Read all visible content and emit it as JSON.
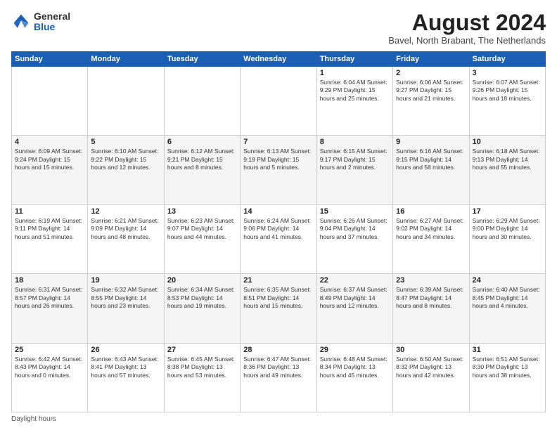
{
  "header": {
    "logo_general": "General",
    "logo_blue": "Blue",
    "month_year": "August 2024",
    "location": "Bavel, North Brabant, The Netherlands"
  },
  "columns": [
    "Sunday",
    "Monday",
    "Tuesday",
    "Wednesday",
    "Thursday",
    "Friday",
    "Saturday"
  ],
  "weeks": [
    [
      {
        "day": "",
        "info": ""
      },
      {
        "day": "",
        "info": ""
      },
      {
        "day": "",
        "info": ""
      },
      {
        "day": "",
        "info": ""
      },
      {
        "day": "1",
        "info": "Sunrise: 6:04 AM\nSunset: 9:29 PM\nDaylight: 15 hours and 25 minutes."
      },
      {
        "day": "2",
        "info": "Sunrise: 6:06 AM\nSunset: 9:27 PM\nDaylight: 15 hours and 21 minutes."
      },
      {
        "day": "3",
        "info": "Sunrise: 6:07 AM\nSunset: 9:26 PM\nDaylight: 15 hours and 18 minutes."
      }
    ],
    [
      {
        "day": "4",
        "info": "Sunrise: 6:09 AM\nSunset: 9:24 PM\nDaylight: 15 hours and 15 minutes."
      },
      {
        "day": "5",
        "info": "Sunrise: 6:10 AM\nSunset: 9:22 PM\nDaylight: 15 hours and 12 minutes."
      },
      {
        "day": "6",
        "info": "Sunrise: 6:12 AM\nSunset: 9:21 PM\nDaylight: 15 hours and 8 minutes."
      },
      {
        "day": "7",
        "info": "Sunrise: 6:13 AM\nSunset: 9:19 PM\nDaylight: 15 hours and 5 minutes."
      },
      {
        "day": "8",
        "info": "Sunrise: 6:15 AM\nSunset: 9:17 PM\nDaylight: 15 hours and 2 minutes."
      },
      {
        "day": "9",
        "info": "Sunrise: 6:16 AM\nSunset: 9:15 PM\nDaylight: 14 hours and 58 minutes."
      },
      {
        "day": "10",
        "info": "Sunrise: 6:18 AM\nSunset: 9:13 PM\nDaylight: 14 hours and 55 minutes."
      }
    ],
    [
      {
        "day": "11",
        "info": "Sunrise: 6:19 AM\nSunset: 9:11 PM\nDaylight: 14 hours and 51 minutes."
      },
      {
        "day": "12",
        "info": "Sunrise: 6:21 AM\nSunset: 9:09 PM\nDaylight: 14 hours and 48 minutes."
      },
      {
        "day": "13",
        "info": "Sunrise: 6:23 AM\nSunset: 9:07 PM\nDaylight: 14 hours and 44 minutes."
      },
      {
        "day": "14",
        "info": "Sunrise: 6:24 AM\nSunset: 9:06 PM\nDaylight: 14 hours and 41 minutes."
      },
      {
        "day": "15",
        "info": "Sunrise: 6:26 AM\nSunset: 9:04 PM\nDaylight: 14 hours and 37 minutes."
      },
      {
        "day": "16",
        "info": "Sunrise: 6:27 AM\nSunset: 9:02 PM\nDaylight: 14 hours and 34 minutes."
      },
      {
        "day": "17",
        "info": "Sunrise: 6:29 AM\nSunset: 9:00 PM\nDaylight: 14 hours and 30 minutes."
      }
    ],
    [
      {
        "day": "18",
        "info": "Sunrise: 6:31 AM\nSunset: 8:57 PM\nDaylight: 14 hours and 26 minutes."
      },
      {
        "day": "19",
        "info": "Sunrise: 6:32 AM\nSunset: 8:55 PM\nDaylight: 14 hours and 23 minutes."
      },
      {
        "day": "20",
        "info": "Sunrise: 6:34 AM\nSunset: 8:53 PM\nDaylight: 14 hours and 19 minutes."
      },
      {
        "day": "21",
        "info": "Sunrise: 6:35 AM\nSunset: 8:51 PM\nDaylight: 14 hours and 15 minutes."
      },
      {
        "day": "22",
        "info": "Sunrise: 6:37 AM\nSunset: 8:49 PM\nDaylight: 14 hours and 12 minutes."
      },
      {
        "day": "23",
        "info": "Sunrise: 6:39 AM\nSunset: 8:47 PM\nDaylight: 14 hours and 8 minutes."
      },
      {
        "day": "24",
        "info": "Sunrise: 6:40 AM\nSunset: 8:45 PM\nDaylight: 14 hours and 4 minutes."
      }
    ],
    [
      {
        "day": "25",
        "info": "Sunrise: 6:42 AM\nSunset: 8:43 PM\nDaylight: 14 hours and 0 minutes."
      },
      {
        "day": "26",
        "info": "Sunrise: 6:43 AM\nSunset: 8:41 PM\nDaylight: 13 hours and 57 minutes."
      },
      {
        "day": "27",
        "info": "Sunrise: 6:45 AM\nSunset: 8:38 PM\nDaylight: 13 hours and 53 minutes."
      },
      {
        "day": "28",
        "info": "Sunrise: 6:47 AM\nSunset: 8:36 PM\nDaylight: 13 hours and 49 minutes."
      },
      {
        "day": "29",
        "info": "Sunrise: 6:48 AM\nSunset: 8:34 PM\nDaylight: 13 hours and 45 minutes."
      },
      {
        "day": "30",
        "info": "Sunrise: 6:50 AM\nSunset: 8:32 PM\nDaylight: 13 hours and 42 minutes."
      },
      {
        "day": "31",
        "info": "Sunrise: 6:51 AM\nSunset: 8:30 PM\nDaylight: 13 hours and 38 minutes."
      }
    ]
  ],
  "footer": "Daylight hours"
}
